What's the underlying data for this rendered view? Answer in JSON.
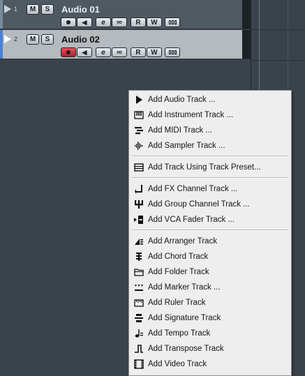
{
  "tracks": [
    {
      "number": "1",
      "name": "Audio 01",
      "buttons": {
        "mute": "M",
        "solo": "S",
        "read": "R",
        "write": "W"
      },
      "selected": false,
      "record_enabled": false
    },
    {
      "number": "2",
      "name": "Audio 02",
      "buttons": {
        "mute": "M",
        "solo": "S",
        "read": "R",
        "write": "W"
      },
      "selected": true,
      "record_enabled": true
    }
  ],
  "menu": {
    "items": [
      {
        "label": "Add Audio Track ...",
        "icon": "audio-track-icon"
      },
      {
        "label": "Add Instrument Track ...",
        "icon": "instrument-track-icon"
      },
      {
        "label": "Add MIDI Track ...",
        "icon": "midi-track-icon"
      },
      {
        "label": "Add Sampler Track ...",
        "icon": "sampler-track-icon"
      },
      {
        "label": "Add Track Using Track Preset...",
        "icon": "track-preset-icon"
      },
      {
        "label": "Add FX Channel Track ...",
        "icon": "fx-channel-icon"
      },
      {
        "label": "Add Group Channel Track ...",
        "icon": "group-channel-icon"
      },
      {
        "label": "Add VCA Fader Track ...",
        "icon": "vca-fader-icon"
      },
      {
        "label": "Add Arranger Track",
        "icon": "arranger-track-icon"
      },
      {
        "label": "Add Chord Track",
        "icon": "chord-track-icon"
      },
      {
        "label": "Add Folder Track",
        "icon": "folder-track-icon"
      },
      {
        "label": "Add Marker Track ...",
        "icon": "marker-track-icon"
      },
      {
        "label": "Add Ruler Track",
        "icon": "ruler-track-icon"
      },
      {
        "label": "Add Signature Track",
        "icon": "signature-track-icon"
      },
      {
        "label": "Add Tempo Track",
        "icon": "tempo-track-icon"
      },
      {
        "label": "Add Transpose Track",
        "icon": "transpose-track-icon"
      },
      {
        "label": "Add Video Track",
        "icon": "video-track-icon"
      }
    ]
  },
  "colors": {
    "background": "#3a434c",
    "selected_track": "#b5babf",
    "record_active": "#d63a45",
    "menu_background": "#eeeeee"
  }
}
